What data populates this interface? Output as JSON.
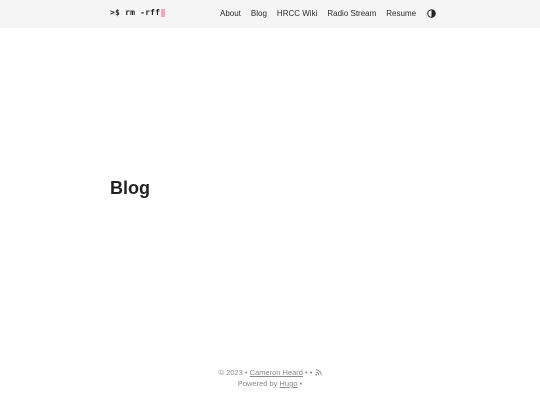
{
  "header": {
    "logo_text": ">$ rm -rff",
    "nav": [
      "About",
      "Blog",
      "HRCC Wiki",
      "Radio Stream",
      "Resume"
    ],
    "theme_icon": "half-circle-contrast-icon"
  },
  "main": {
    "title": "Blog"
  },
  "footer": {
    "copyright": "© 2023 •",
    "author": "Cameron Heard",
    "sep1": "•",
    "sep2": "•",
    "powered_by": "Powered by",
    "engine": "Hugo",
    "sep3": "•",
    "rss_icon": "rss-icon"
  },
  "colors": {
    "header_bg": "#f5f5f5",
    "cursor": "#f2a8be",
    "text": "#222222",
    "footer_text": "#8a8a8a"
  }
}
